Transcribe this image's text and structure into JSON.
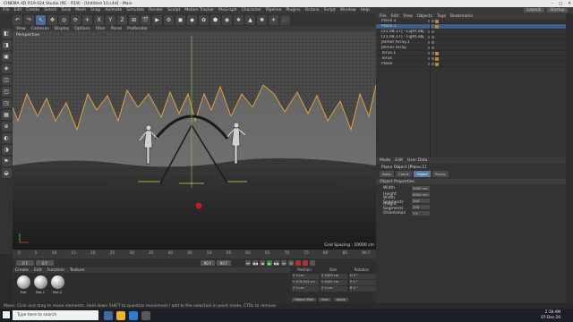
{
  "window": {
    "title": "CINEMA 4D R19.024 Studio (RC - R19) - [Untitled 10.c4d] - Main",
    "controls": [
      "–",
      "□",
      "✕"
    ]
  },
  "menubar": {
    "items": [
      "File",
      "Edit",
      "Create",
      "Select",
      "Tools",
      "Mesh",
      "Snap",
      "Animate",
      "Simulate",
      "Render",
      "Sculpt",
      "Motion Tracker",
      "MoGraph",
      "Character",
      "Pipeline",
      "Plugins",
      "Octane",
      "Script",
      "Window",
      "Help"
    ],
    "layout_label": "Layout:",
    "layout_value": "Startup"
  },
  "toolbar": {
    "buttons": [
      "↶",
      "↷",
      "↖",
      "✥",
      "◎",
      "⟳",
      "✛",
      "X",
      "Y",
      "Z",
      "⊞",
      "🎬",
      "▶",
      "⚙",
      "◼",
      "◆",
      "✿",
      "⬟",
      "◉",
      "❖",
      "▲",
      "✺",
      "☀",
      "🎥"
    ]
  },
  "left_tools": [
    "◧",
    "◨",
    "▣",
    "◈",
    "◫",
    "◰",
    "◳",
    "▦",
    "⊕",
    "◐",
    "◑",
    "⚑",
    "◒"
  ],
  "viewport": {
    "menu": [
      "View",
      "Cameras",
      "Display",
      "Options",
      "Filter",
      "Panel",
      "ProRender"
    ],
    "label": "Perspective",
    "grid_spacing": "Grid Spacing : 10000 cm"
  },
  "timeline": {
    "ticks": [
      "0",
      "5",
      "10",
      "15",
      "20",
      "25",
      "30",
      "35",
      "40",
      "45",
      "50",
      "55",
      "60",
      "65",
      "70",
      "75",
      "80",
      "85",
      "90 F"
    ]
  },
  "playbar": {
    "start_field": "0 F",
    "current_field": "0 F",
    "end_field": "90 F",
    "end_field2": "90 F",
    "controls": [
      "⏮",
      "◀◀",
      "◀",
      "▶",
      "▶▶",
      "⏭",
      "⟲"
    ]
  },
  "materials": {
    "menu": [
      "Create",
      "Edit",
      "Function",
      "Texture"
    ],
    "items": [
      {
        "name": "Mat"
      },
      {
        "name": "Mat.1"
      },
      {
        "name": "Mat.2"
      }
    ]
  },
  "coordinates": {
    "headers": [
      "Position",
      "Size",
      "Rotation"
    ],
    "rows": [
      [
        "X 0 cm",
        "X 2000 cm",
        "H 0 °"
      ],
      [
        "Y 474.443 cm",
        "Y 2000 cm",
        "P 0 °"
      ],
      [
        "Z 0 cm",
        "Z 0 cm",
        "B 0 °"
      ]
    ],
    "mode": "Object (Rel)",
    "size_mode": "Size",
    "apply": "Apply"
  },
  "object_manager": {
    "menu": [
      "File",
      "Edit",
      "View",
      "Objects",
      "Tags",
      "Bookmarks"
    ],
    "objects": [
      {
        "name": "Plane.2",
        "selected": false,
        "tag": true
      },
      {
        "name": "Plane.1",
        "selected": true,
        "tag": true
      },
      {
        "name": "[21.08.17] - Light.obj",
        "selected": false,
        "tag": false
      },
      {
        "name": "[21.08.17] - Light.obj",
        "selected": false,
        "tag": false
      },
      {
        "name": "Jelmer Array.1",
        "selected": false,
        "tag": false
      },
      {
        "name": "Jelmer Array",
        "selected": false,
        "tag": false
      },
      {
        "name": "Torus.1",
        "selected": false,
        "tag": true
      },
      {
        "name": "Torus",
        "selected": false,
        "tag": true
      },
      {
        "name": "Plane",
        "selected": false,
        "tag": true
      }
    ]
  },
  "attributes": {
    "menu": [
      "Mode",
      "Edit",
      "User Data"
    ],
    "title": "Plane Object [Plane.1]",
    "tabs": [
      "Basic",
      "Coord.",
      "Object",
      "Phong"
    ],
    "active_tab": "Object",
    "section": "Object Properties",
    "props": [
      {
        "label": "Width",
        "value": "2000 cm"
      },
      {
        "label": "Height",
        "value": "2000 cm"
      },
      {
        "label": "Width Segments",
        "value": "200"
      },
      {
        "label": "Height Segments",
        "value": "200"
      },
      {
        "label": "Orientation",
        "value": "+Y"
      }
    ]
  },
  "statusbar": {
    "text": "Move: Click and drag to move elements. Hold down SHIFT to quantize movement / add to the selection in point mode, CTRL to remove."
  },
  "taskbar": {
    "search_placeholder": "Type here to search",
    "time": "2:18 AM",
    "date": "07-Dec-20"
  },
  "colors": {
    "accent": "#5a7aa6",
    "selection": "#3f5f8a",
    "orange": "#e0a040"
  }
}
